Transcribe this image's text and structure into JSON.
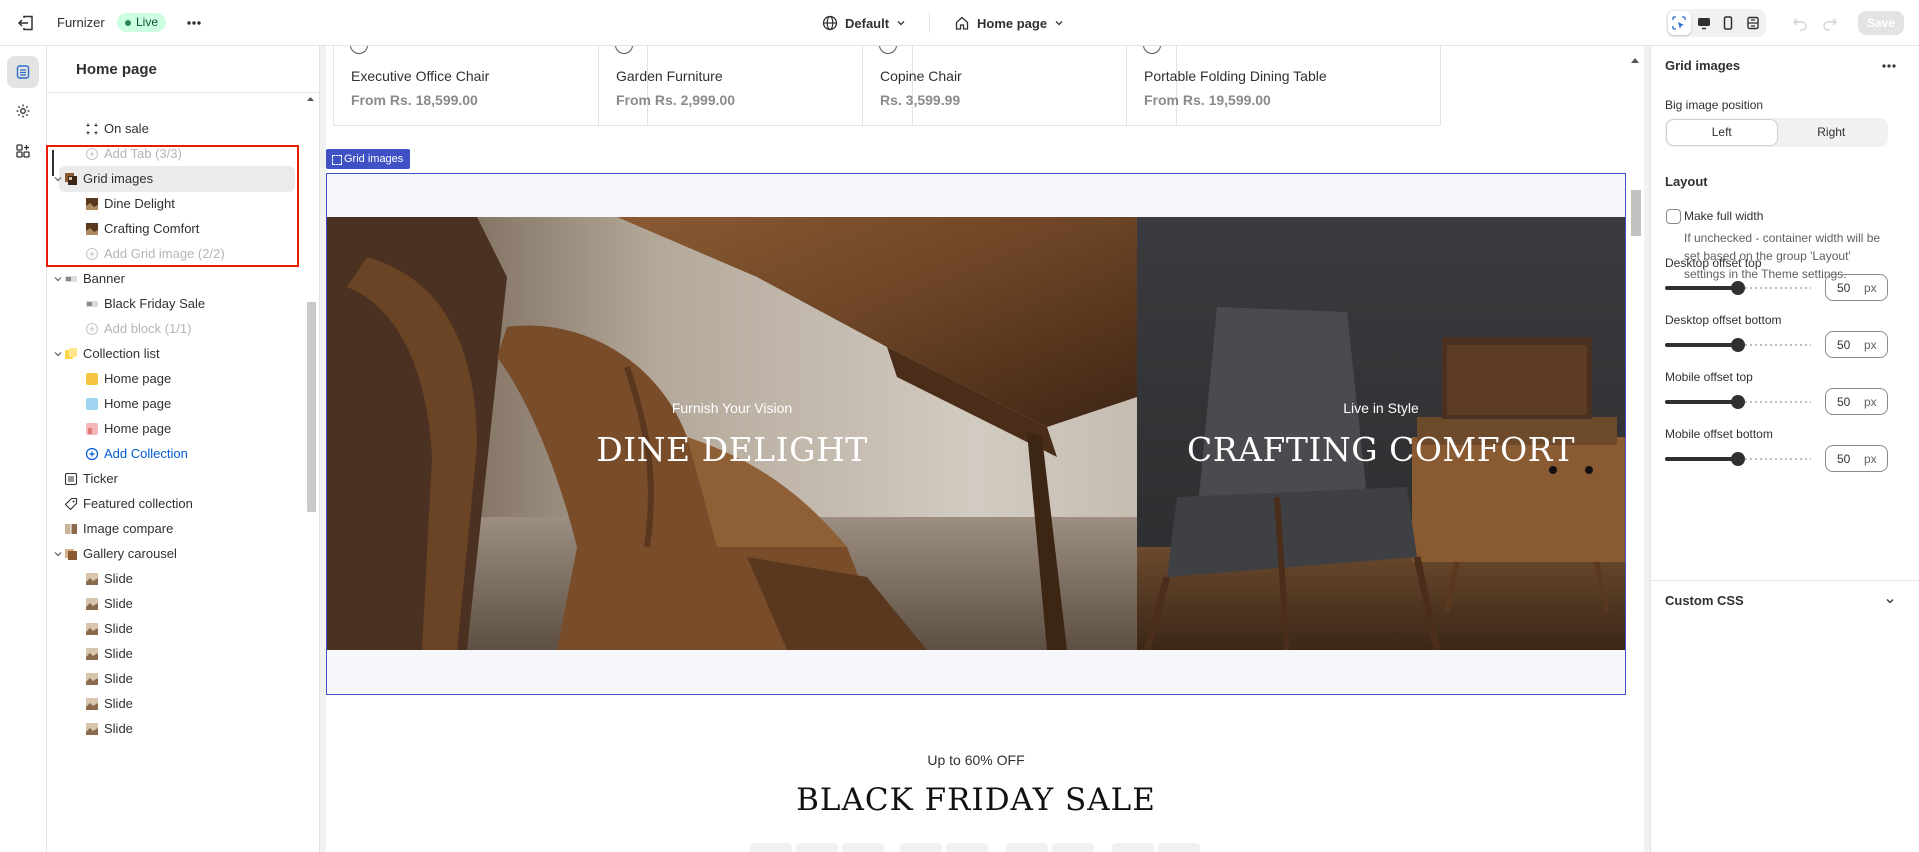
{
  "topbar": {
    "store_name": "Furnizer",
    "status": "Live",
    "theme": "Default",
    "page": "Home page",
    "save_label": "Save"
  },
  "sidebar": {
    "title": "Home page",
    "items": [
      {
        "label": "On sale",
        "level": "child",
        "icon": "collection-icon"
      },
      {
        "label": "Add Tab (3/3)",
        "level": "add",
        "icon": "plus-circle-icon"
      },
      {
        "label": "Grid images",
        "level": "section",
        "icon": "grid-images-icon",
        "expanded": true,
        "selected": true
      },
      {
        "label": "Dine Delight",
        "level": "child",
        "icon": "image-thumb-icon"
      },
      {
        "label": "Crafting Comfort",
        "level": "child",
        "icon": "image-thumb-icon"
      },
      {
        "label": "Add Grid image (2/2)",
        "level": "add",
        "icon": "plus-circle-icon"
      },
      {
        "label": "Banner",
        "level": "section",
        "icon": "banner-icon",
        "expanded": true
      },
      {
        "label": "Black Friday Sale",
        "level": "child",
        "icon": "banner-icon"
      },
      {
        "label": "Add block (1/1)",
        "level": "add",
        "icon": "plus-circle-icon"
      },
      {
        "label": "Collection list",
        "level": "section",
        "icon": "collection-list-icon",
        "expanded": true
      },
      {
        "label": "Home page",
        "level": "child",
        "icon": "swatch-yellow-icon"
      },
      {
        "label": "Home page",
        "level": "child",
        "icon": "swatch-blue-icon"
      },
      {
        "label": "Home page",
        "level": "child",
        "icon": "swatch-pink-icon"
      },
      {
        "label": "Add Collection",
        "level": "link",
        "icon": "plus-circle-blue-icon"
      },
      {
        "label": "Ticker",
        "level": "section-leaf",
        "icon": "ticker-icon"
      },
      {
        "label": "Featured collection",
        "level": "section-leaf",
        "icon": "tag-icon"
      },
      {
        "label": "Image compare",
        "level": "section-leaf",
        "icon": "image-compare-icon"
      },
      {
        "label": "Gallery carousel",
        "level": "section",
        "icon": "gallery-icon",
        "expanded": true
      },
      {
        "label": "Slide",
        "level": "child",
        "icon": "slide-thumb-icon"
      },
      {
        "label": "Slide",
        "level": "child",
        "icon": "slide-thumb-icon"
      },
      {
        "label": "Slide",
        "level": "child",
        "icon": "slide-thumb-icon"
      },
      {
        "label": "Slide",
        "level": "child",
        "icon": "slide-thumb-icon"
      },
      {
        "label": "Slide",
        "level": "child",
        "icon": "slide-thumb-icon"
      },
      {
        "label": "Slide",
        "level": "child",
        "icon": "slide-thumb-icon"
      },
      {
        "label": "Slide",
        "level": "child",
        "icon": "slide-thumb-icon"
      }
    ]
  },
  "canvas": {
    "products": [
      {
        "name": "Executive Office Chair",
        "price": "From Rs. 18,599.00"
      },
      {
        "name": "Garden Furniture",
        "price": "From Rs. 2,999.00"
      },
      {
        "name": "Copine Chair",
        "price": "Rs. 3,599.99"
      },
      {
        "name": "Portable Folding Dining Table",
        "price": "From Rs. 19,599.00"
      }
    ],
    "section_tag": "Grid images",
    "grid": [
      {
        "kicker": "Furnish Your Vision",
        "heading": "DINE DELIGHT"
      },
      {
        "kicker": "Live in Style",
        "heading": "CRAFTING COMFORT"
      }
    ],
    "banner": {
      "kicker": "Up to 60% OFF",
      "title": "BLACK FRIDAY SALE"
    }
  },
  "panel": {
    "title": "Grid images",
    "big_image_position_label": "Big image position",
    "position_options": [
      "Left",
      "Right"
    ],
    "position_selected": "Left",
    "layout_heading": "Layout",
    "full_width_label": "Make full width",
    "full_width_checked": false,
    "full_width_help": "If unchecked - container width will be set based on the group 'Layout' settings in the Theme settings.",
    "offsets": [
      {
        "label": "Desktop offset top",
        "value": "50",
        "unit": "px",
        "level": 0.5
      },
      {
        "label": "Desktop offset bottom",
        "value": "50",
        "unit": "px",
        "level": 0.5
      },
      {
        "label": "Mobile offset top",
        "value": "50",
        "unit": "px",
        "level": 0.5
      },
      {
        "label": "Mobile offset bottom",
        "value": "50",
        "unit": "px",
        "level": 0.5
      }
    ],
    "custom_css_label": "Custom CSS"
  }
}
